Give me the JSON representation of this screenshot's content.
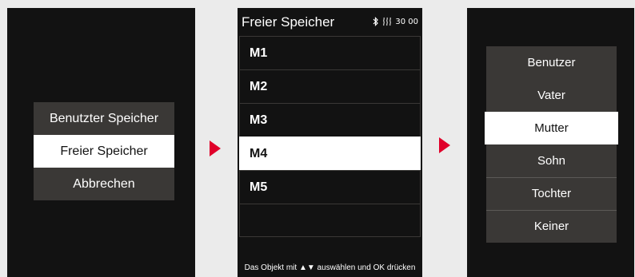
{
  "screen1": {
    "items": [
      "Benutzter Speicher",
      "Freier Speicher",
      "Abbrechen"
    ]
  },
  "screen2": {
    "title": "Freier Speicher",
    "time": "30 00",
    "icons": [
      "bluetooth-icon",
      "heat-icon"
    ],
    "slots": [
      "M1",
      "M2",
      "M3",
      "M4",
      "M5",
      ""
    ],
    "footer": "Das Objekt mit ▲▼ auswählen und OK drücken"
  },
  "screen3": {
    "items": [
      "Benutzer",
      "Vater",
      "Mutter",
      "Sohn",
      "Tochter",
      "Keiner"
    ]
  },
  "colors": {
    "accent_arrow": "#e0002a",
    "screen_bg": "#121212",
    "panel_bg": "#3a3836",
    "selected_bg": "#ffffff"
  }
}
